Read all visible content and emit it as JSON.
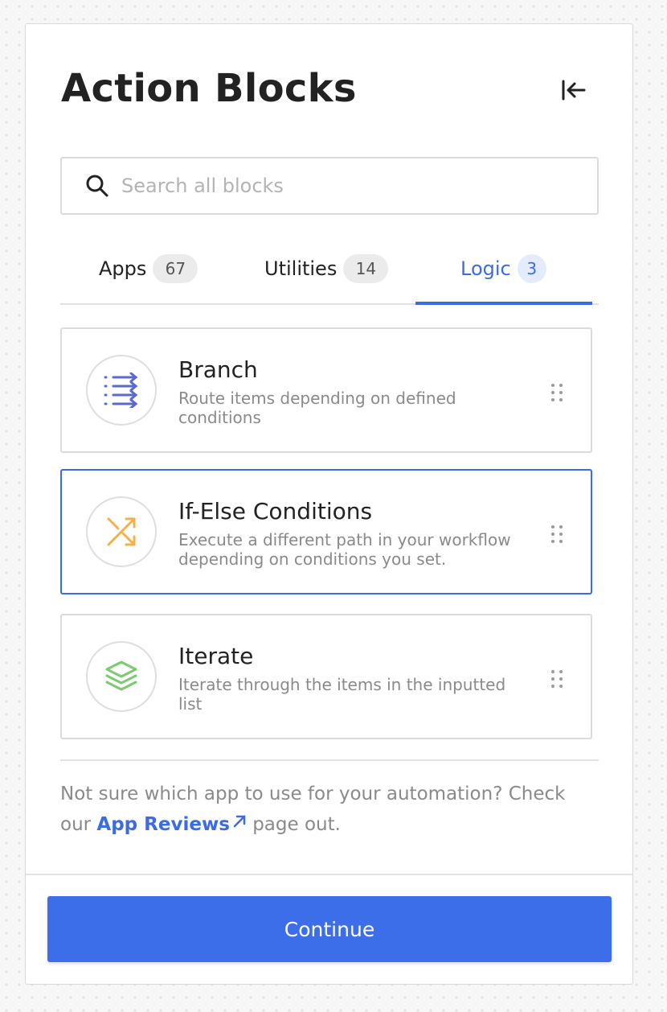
{
  "header": {
    "title": "Action Blocks",
    "collapse_icon": "collapse-left-icon"
  },
  "search": {
    "placeholder": "Search all blocks",
    "value": "",
    "icon": "search-icon"
  },
  "tabs": [
    {
      "label": "Apps",
      "count": "67",
      "active": false
    },
    {
      "label": "Utilities",
      "count": "14",
      "active": false
    },
    {
      "label": "Logic",
      "count": "3",
      "active": true
    }
  ],
  "blocks": [
    {
      "name": "Branch",
      "description": "Route items depending on defined conditions",
      "icon": "branch-icon",
      "icon_color": "#5b6ad0",
      "selected": false
    },
    {
      "name": "If-Else Conditions",
      "description": "Execute a different path in your workflow depending on conditions you set.",
      "icon": "shuffle-icon",
      "icon_color": "#f5b04a",
      "selected": true
    },
    {
      "name": "Iterate",
      "description": "Iterate through the items in the inputted list",
      "icon": "layers-icon",
      "icon_color": "#7cc96f",
      "selected": false
    }
  ],
  "note": {
    "before": "Not sure which app to use for your automation? Check our ",
    "link": "App Reviews",
    "after": " page out."
  },
  "footer": {
    "continue_label": "Continue"
  },
  "colors": {
    "accent": "#3b6ce3",
    "button": "#3d6ee9"
  }
}
